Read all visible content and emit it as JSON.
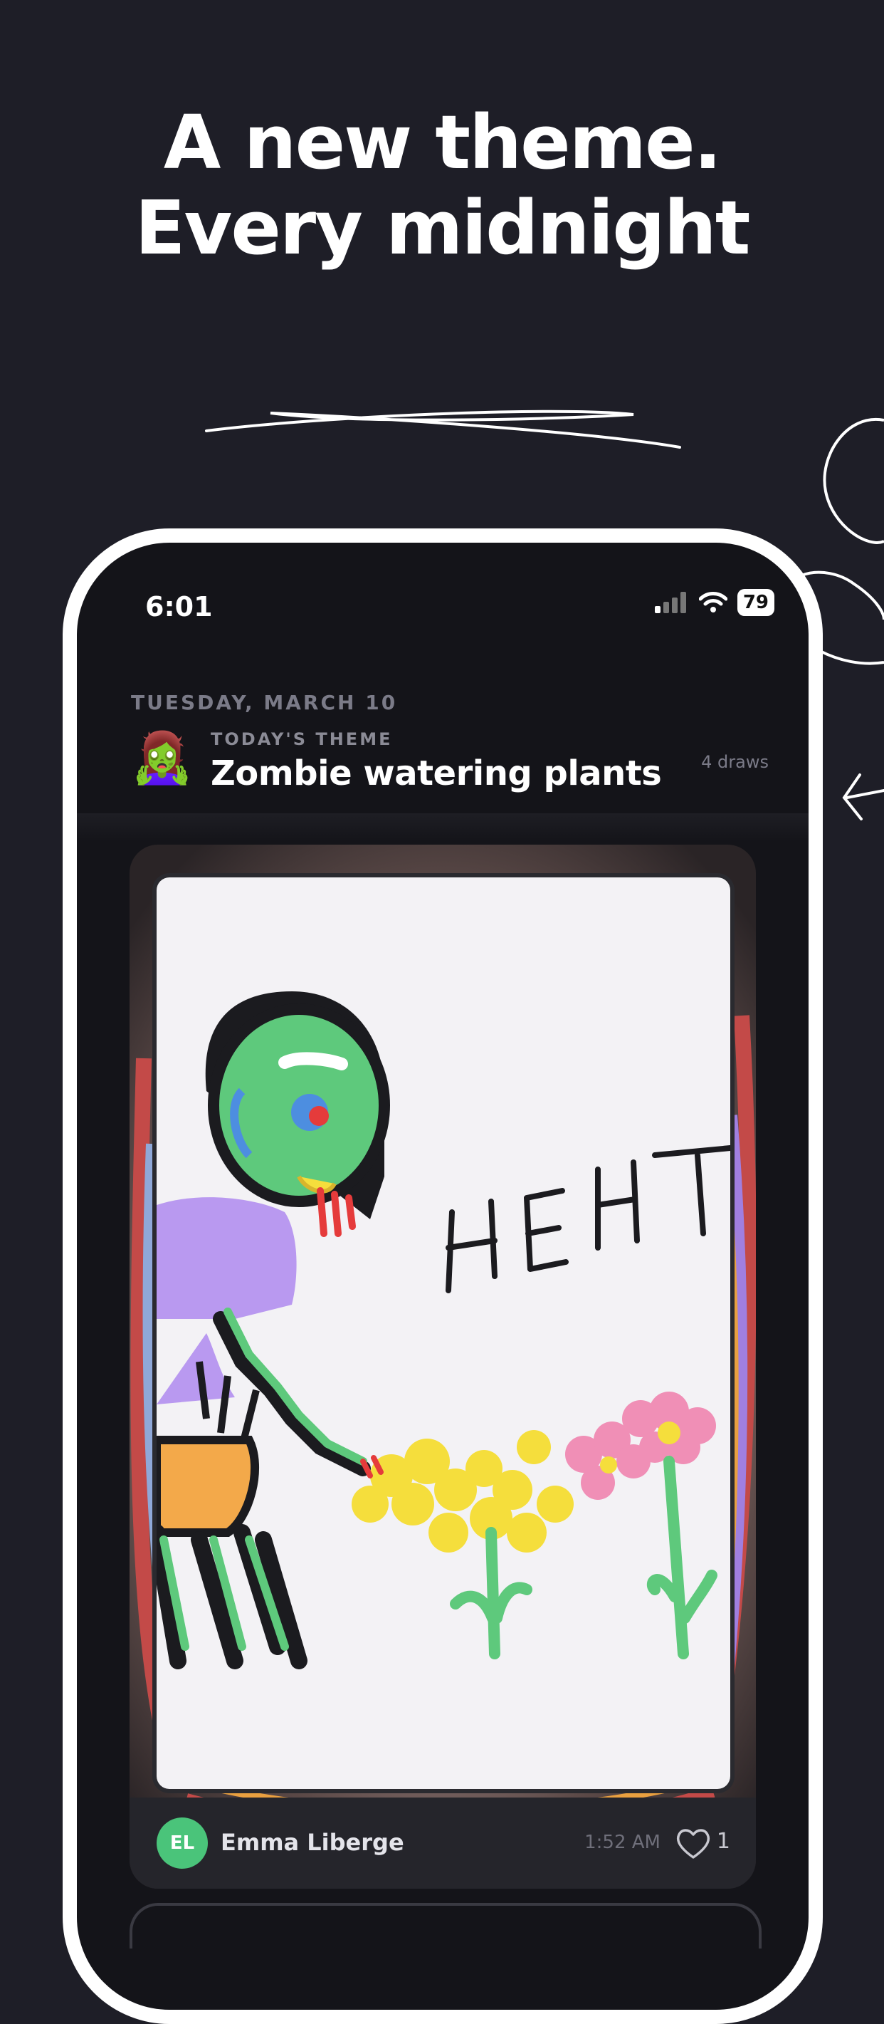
{
  "headline": {
    "line1": "A new theme.",
    "line2": "Every midnight"
  },
  "status_bar": {
    "time": "6:01",
    "battery": "79"
  },
  "feed": {
    "date": "TUESDAY, MARCH 10",
    "theme_label": "TODAY'S THEME",
    "theme_emoji": "🧟‍♀️",
    "theme_title": "Zombie watering plants",
    "draws": "4 draws"
  },
  "post": {
    "drawing_text": "HEHT",
    "author_initials": "EL",
    "author_name": "Emma Liberge",
    "time": "1:52 AM",
    "likes": "1"
  },
  "icons": {
    "signal": "cellular-signal-icon",
    "wifi": "wifi-icon",
    "battery": "battery-icon",
    "like": "heart-icon"
  },
  "colors": {
    "background": "#1e1e27",
    "avatar": "#4ac47a",
    "zombie_skin": "#5ec97c",
    "shirt": "#b999f0",
    "pants": "#f3a94a",
    "flower_yellow": "#f5de3c",
    "flower_pink": "#f08fb6"
  }
}
